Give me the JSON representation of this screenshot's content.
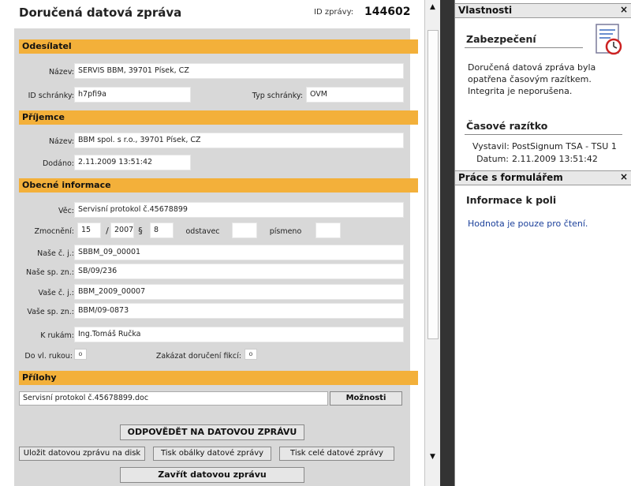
{
  "form": {
    "title": "Doručená datová zpráva",
    "id_label": "ID zprávy:",
    "id_value": "144602"
  },
  "sender": {
    "section": "Odesílatel",
    "name_label": "Název:",
    "name_value": "SERVIS BBM, 39701 Písek, CZ",
    "box_id_label": "ID schránky:",
    "box_id_value": "h7pfi9a",
    "box_type_label": "Typ schránky:",
    "box_type_value": "OVM"
  },
  "recipient": {
    "section": "Příjemce",
    "name_label": "Název:",
    "name_value": "BBM spol. s r.o., 39701 Písek, CZ",
    "delivered_label": "Dodáno:",
    "delivered_value": "2.11.2009 13:51:42"
  },
  "general": {
    "section": "Obecné informace",
    "subject_label": "Věc:",
    "subject_value": "Servisní protokol č.45678899",
    "auth_label": "Zmocnění:",
    "auth_num": "15",
    "auth_slash": "/",
    "auth_year": "2007",
    "auth_par": "§",
    "auth_par_value": "8",
    "auth_odst_label": "odstavec",
    "auth_odst_value": "",
    "auth_pism_label": "písmeno",
    "auth_pism_value": "",
    "our_ref_label": "Naše č. j.:",
    "our_ref_value": "SBBM_09_00001",
    "our_file_label": "Naše sp. zn.:",
    "our_file_value": "SB/09/236",
    "your_ref_label": "Vaše č. j.:",
    "your_ref_value": "BBM_2009_00007",
    "your_file_label": "Vaše sp. zn.:",
    "your_file_value": "BBM/09-0873",
    "attn_label": "K rukám:",
    "attn_value": "Ing.Tomáš Ručka",
    "personal_label": "Do vl. rukou:",
    "personal_value": "o",
    "fiction_label": "Zakázat doručení fikcí:",
    "fiction_value": "o"
  },
  "attachments": {
    "section": "Přílohy",
    "file": "Servisní protokol č.45678899.doc",
    "options_label": "Možnosti"
  },
  "buttons": {
    "reply": "ODPOVĚDĚT NA DATOVOU ZPRÁVU",
    "save": "Uložit datovou zprávu na disk",
    "print_envelope": "Tisk obálky datové zprávy",
    "print_full": "Tisk celé datové zprávy",
    "close": "Zavřít datovou zprávu"
  },
  "scrollbar": {
    "up_icon": "▲",
    "down_icon": "▼"
  },
  "properties": {
    "header": "Vlastnosti",
    "close_icon": "×",
    "security_title": "Zabezpečení",
    "security_text_1": "Doručená datová zpráva byla",
    "security_text_2": "opatřena  časovým razítkem.",
    "security_text_3": "Integrita je neporušena.",
    "timestamp_title": "Časové razítko",
    "issuer_label": "Vystavil:",
    "issuer_value": "PostSignum TSA - TSU 1",
    "date_label": "Datum:",
    "date_value": "2.11.2009 13:51:42"
  },
  "form_work": {
    "header": "Práce s formulářem",
    "close_icon": "×",
    "field_info_title": "Informace k poli",
    "field_info_text": "Hodnota je pouze pro čtení."
  },
  "colors": {
    "section_bar": "#f3b03a",
    "form_bg": "#d8d8d8",
    "info_text": "#1a3f9a"
  }
}
